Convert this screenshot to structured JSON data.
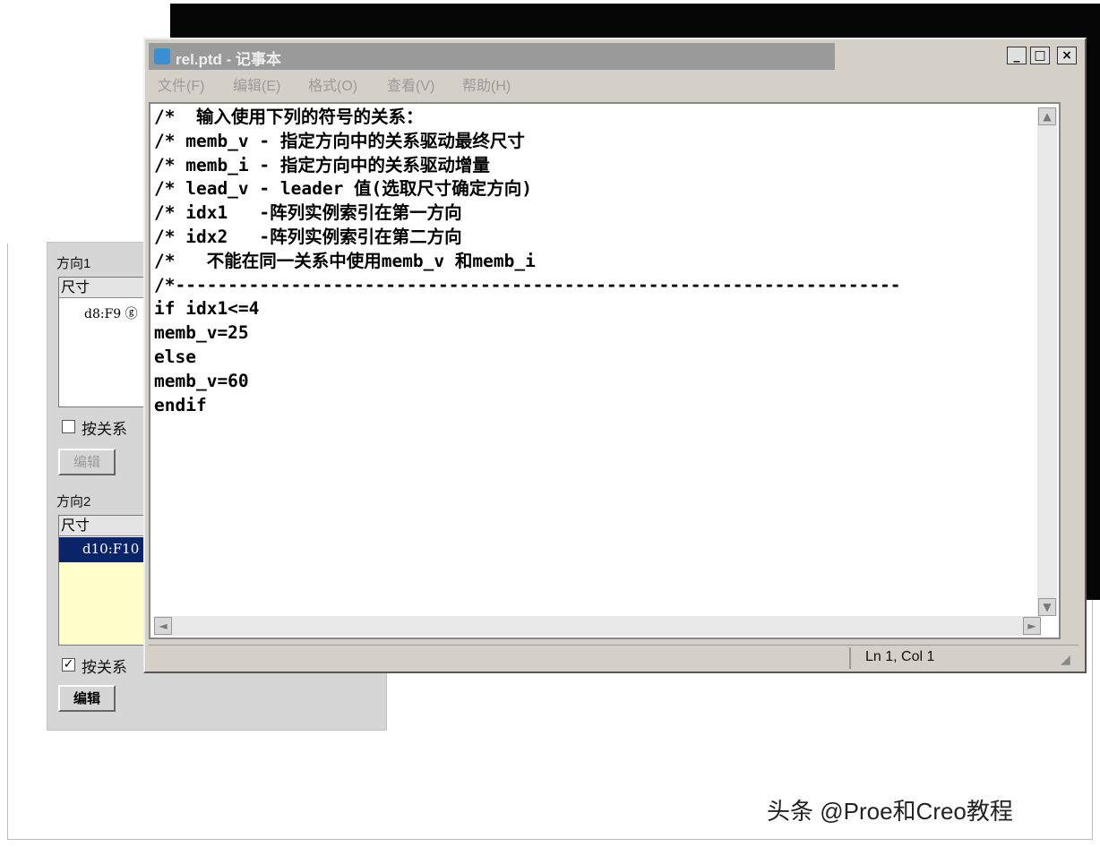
{
  "watermark": "头条 @Proe和Creo教程",
  "panel": {
    "dir1_label": "方向1",
    "dir1_header": "尺寸",
    "dir1_row": "d8:F9 ⓖ",
    "dir1_check_label": "按关系",
    "dir1_check_mark": "",
    "dir1_edit_btn": "编辑",
    "dir2_label": "方向2",
    "dir2_header": "尺寸",
    "dir2_row": "d10:F10",
    "dir2_check_label": "按关系",
    "dir2_check_mark": "✓",
    "dir2_edit_btn": "编辑",
    "selected_color": "#0a246a",
    "highlight_color": "#ffffcc"
  },
  "notepad": {
    "title": "rel.ptd - 记事本",
    "buttons": {
      "minimize": "_",
      "maximize": "□",
      "close": "×"
    },
    "menu": [
      "文件(F)",
      "编辑(E)",
      "格式(O)",
      "查看(V)",
      "帮助(H)"
    ],
    "content": "/*  输入使用下列的符号的关系：\n/* memb_v - 指定方向中的关系驱动最终尺寸\n/* memb_i - 指定方向中的关系驱动增量\n/* lead_v - leader 值(选取尺寸确定方向)\n/* idx1   -阵列实例索引在第一方向\n/* idx2   -阵列实例索引在第二方向\n/*   不能在同一关系中使用memb_v 和memb_i\n/*---------------------------------------------------------------------\nif idx1<=4\nmemb_v=25\nelse\nmemb_v=60\nendif",
    "status": "Ln 1, Col 1",
    "scroll_up": "▲",
    "scroll_down": "▼",
    "scroll_left": "◄",
    "scroll_right": "►"
  }
}
